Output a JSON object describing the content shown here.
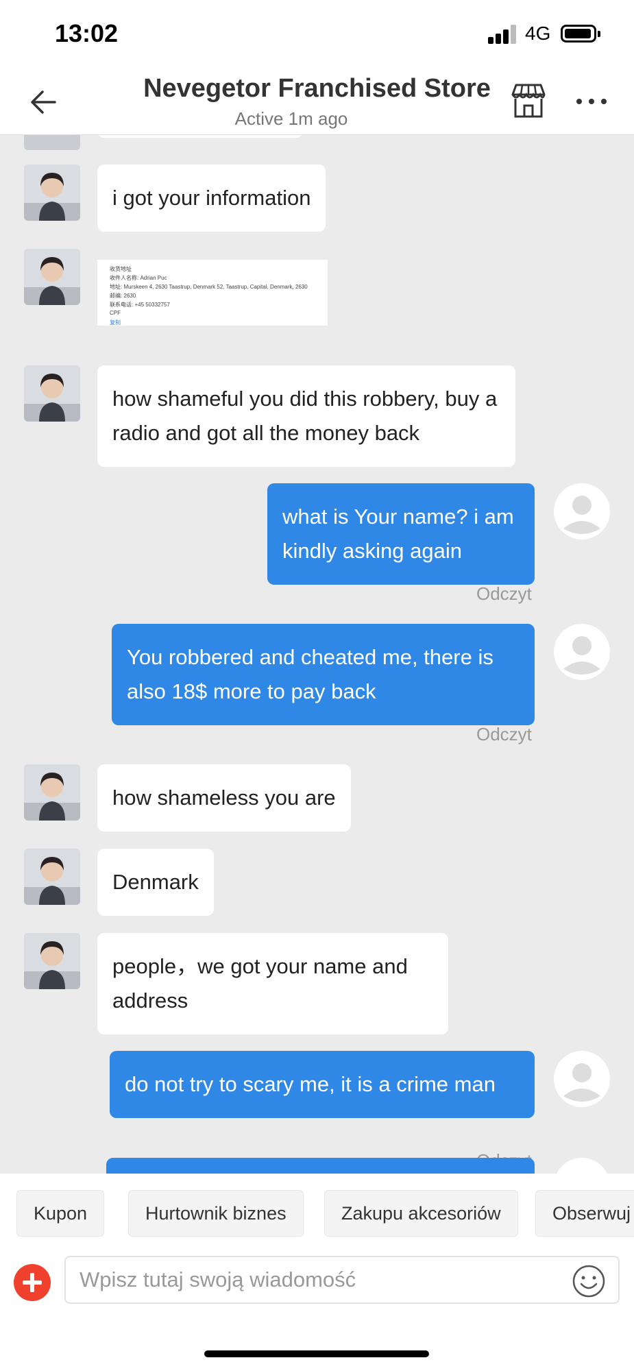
{
  "status_bar": {
    "time": "13:02",
    "network": "4G"
  },
  "header": {
    "title": "Nevegetor Franchised Store",
    "subtitle": "Active 1m ago"
  },
  "messages": [
    {
      "from": "store",
      "text": "i got your information"
    },
    {
      "from": "store",
      "type": "image",
      "lines": [
        "收货地址",
        "收件人名称:  Adrian Puc",
        "地址:  Murskeen 4, 2630 Taastrup, Denmark 52, Taastrup, Capital, Denmark, 2630",
        "邮编:  2630",
        "联系电话:  +45 50332757",
        "CPF",
        "复制"
      ]
    },
    {
      "from": "store",
      "text": "how shameful you did this robbery, buy a radio and got all the money back"
    },
    {
      "from": "me",
      "text": "what is Your name? i am kindly asking again",
      "status": "Odczyt"
    },
    {
      "from": "me",
      "text": "You robbered and cheated me, there is also 18$ more to pay back",
      "status": "Odczyt"
    },
    {
      "from": "store",
      "text": "how shameless you are"
    },
    {
      "from": "store",
      "text": "Denmark"
    },
    {
      "from": "store",
      "text": "people，we got your name and address"
    },
    {
      "from": "me",
      "text": "do not try to scary me, it is a crime man",
      "status": "Odczyt"
    }
  ],
  "quick_replies": [
    "Kupon",
    "Hurtownik biznes",
    "Zakupu akcesoriów",
    "Obserwuj"
  ],
  "composer": {
    "placeholder": "Wpisz tutaj swoją wiadomość"
  },
  "colors": {
    "outgoing_bubble": "#2f87e6",
    "incoming_bubble": "#ffffff",
    "chat_background": "#ebebeb",
    "plus_button": "#f0402e"
  },
  "icons": [
    "back-arrow-icon",
    "store-icon",
    "more-icon",
    "plus-icon",
    "emoji-icon"
  ]
}
